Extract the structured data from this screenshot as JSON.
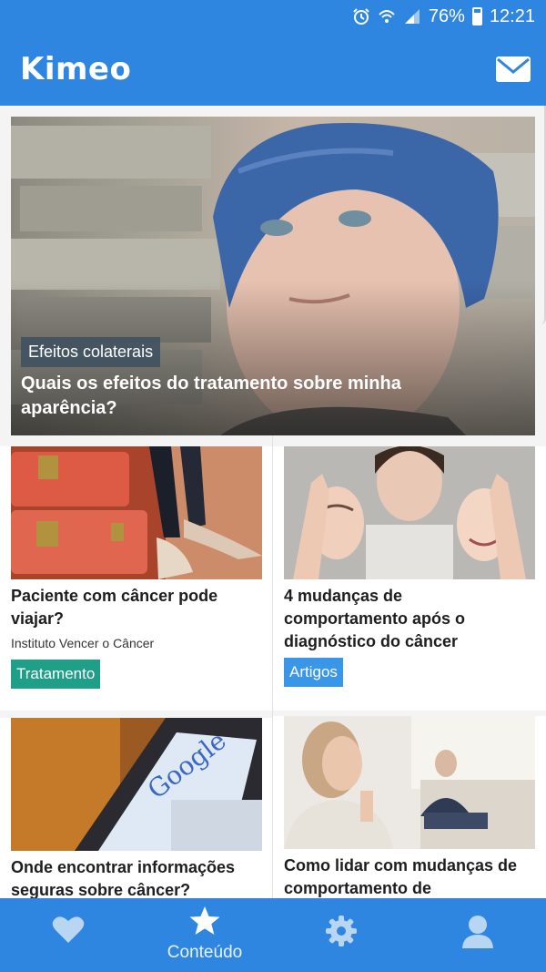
{
  "status_bar": {
    "battery": "76%",
    "time": "12:21",
    "icons": [
      "alarm-icon",
      "wifi-icon",
      "signal-icon",
      "battery-icon"
    ]
  },
  "app": {
    "title": "Kimeo",
    "mail_icon": "mail-icon"
  },
  "colors": {
    "primary": "#2f86e0",
    "tag_tratamento": "#1f9e88",
    "tag_artigos": "#3a97e8",
    "tag_hero": "#3c505f"
  },
  "hero": {
    "category": "Efeitos colaterais",
    "title": "Quais os efeitos do tratamento sobre minha aparência?"
  },
  "cards": [
    {
      "title": "Paciente com câncer pode viajar?",
      "source": "Instituto Vencer o Câncer",
      "category": "Tratamento"
    },
    {
      "title": "4 mudanças de comportamento após o diagnóstico do câncer",
      "category": "Artigos"
    },
    {
      "title": "Onde encontrar informações seguras sobre câncer?",
      "image_text": "Google"
    },
    {
      "title": "Como lidar com mudanças de comportamento de"
    }
  ],
  "bottom_nav": {
    "items": [
      {
        "icon": "heart-icon",
        "label": ""
      },
      {
        "icon": "star-icon",
        "label": "Conteúdo",
        "active": true
      },
      {
        "icon": "gear-icon",
        "label": ""
      },
      {
        "icon": "user-icon",
        "label": ""
      }
    ]
  }
}
